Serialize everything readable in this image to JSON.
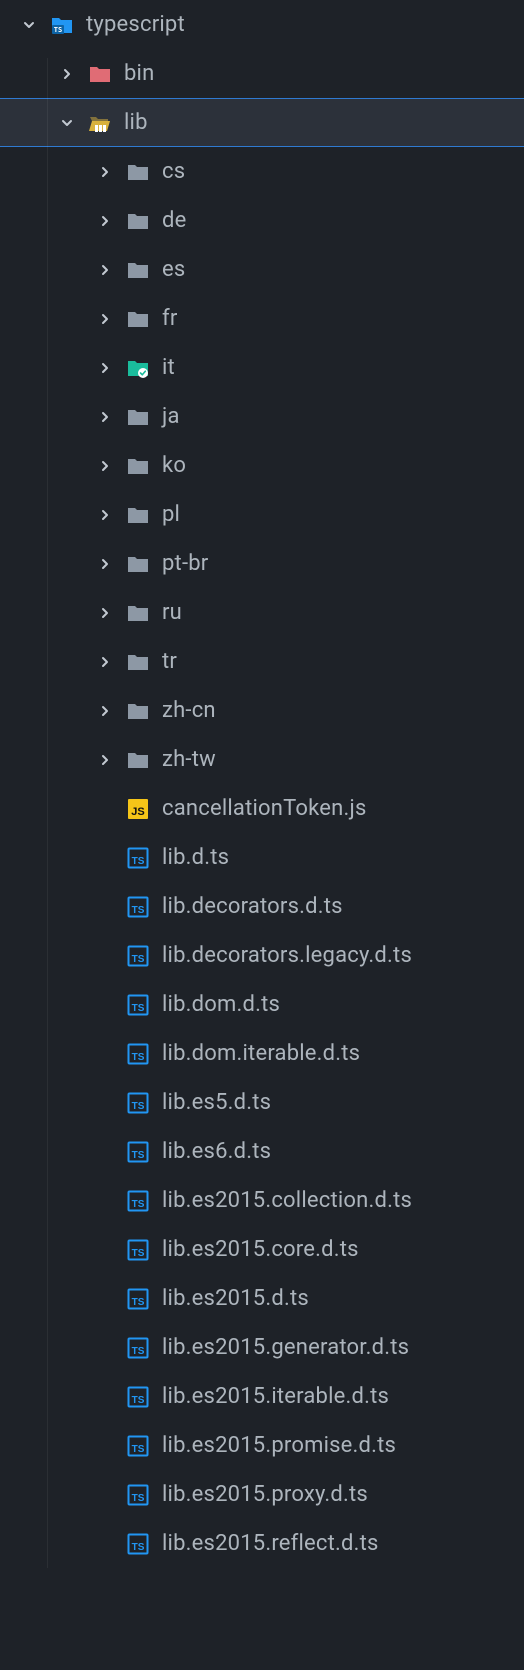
{
  "colors": {
    "bg": "#1e2228",
    "selectedBg": "#2c313a",
    "selectedBorder": "#2f7ad1",
    "text": "#adb5bd",
    "folderIcon": "#8d98a5",
    "tsBlue": "#2196f3",
    "jsYellow": "#f5c518",
    "binRed": "#e06c75",
    "libYellow": "#d8b13d",
    "itTeal": "#1abc9c",
    "tsRootBlue": "#2196f3"
  },
  "rows": [
    {
      "depth": 0,
      "chevron": "down",
      "iconType": "folder-ts-root",
      "label": "typescript",
      "interact": true,
      "selected": false
    },
    {
      "depth": 1,
      "chevron": "right",
      "iconType": "folder-bin",
      "label": "bin",
      "interact": true,
      "selected": false
    },
    {
      "depth": 1,
      "chevron": "down",
      "iconType": "folder-lib",
      "label": "lib",
      "interact": true,
      "selected": true
    },
    {
      "depth": 2,
      "chevron": "right",
      "iconType": "folder",
      "label": "cs",
      "interact": true,
      "selected": false
    },
    {
      "depth": 2,
      "chevron": "right",
      "iconType": "folder",
      "label": "de",
      "interact": true,
      "selected": false
    },
    {
      "depth": 2,
      "chevron": "right",
      "iconType": "folder",
      "label": "es",
      "interact": true,
      "selected": false
    },
    {
      "depth": 2,
      "chevron": "right",
      "iconType": "folder",
      "label": "fr",
      "interact": true,
      "selected": false
    },
    {
      "depth": 2,
      "chevron": "right",
      "iconType": "folder-it",
      "label": "it",
      "interact": true,
      "selected": false
    },
    {
      "depth": 2,
      "chevron": "right",
      "iconType": "folder",
      "label": "ja",
      "interact": true,
      "selected": false
    },
    {
      "depth": 2,
      "chevron": "right",
      "iconType": "folder",
      "label": "ko",
      "interact": true,
      "selected": false
    },
    {
      "depth": 2,
      "chevron": "right",
      "iconType": "folder",
      "label": "pl",
      "interact": true,
      "selected": false
    },
    {
      "depth": 2,
      "chevron": "right",
      "iconType": "folder",
      "label": "pt-br",
      "interact": true,
      "selected": false
    },
    {
      "depth": 2,
      "chevron": "right",
      "iconType": "folder",
      "label": "ru",
      "interact": true,
      "selected": false
    },
    {
      "depth": 2,
      "chevron": "right",
      "iconType": "folder",
      "label": "tr",
      "interact": true,
      "selected": false
    },
    {
      "depth": 2,
      "chevron": "right",
      "iconType": "folder",
      "label": "zh-cn",
      "interact": true,
      "selected": false
    },
    {
      "depth": 2,
      "chevron": "right",
      "iconType": "folder",
      "label": "zh-tw",
      "interact": true,
      "selected": false
    },
    {
      "depth": 2,
      "chevron": "none",
      "iconType": "file-js",
      "label": "cancellationToken.js",
      "interact": true,
      "selected": false
    },
    {
      "depth": 2,
      "chevron": "none",
      "iconType": "file-ts",
      "label": "lib.d.ts",
      "interact": true,
      "selected": false
    },
    {
      "depth": 2,
      "chevron": "none",
      "iconType": "file-ts",
      "label": "lib.decorators.d.ts",
      "interact": true,
      "selected": false
    },
    {
      "depth": 2,
      "chevron": "none",
      "iconType": "file-ts",
      "label": "lib.decorators.legacy.d.ts",
      "interact": true,
      "selected": false
    },
    {
      "depth": 2,
      "chevron": "none",
      "iconType": "file-ts",
      "label": "lib.dom.d.ts",
      "interact": true,
      "selected": false
    },
    {
      "depth": 2,
      "chevron": "none",
      "iconType": "file-ts",
      "label": "lib.dom.iterable.d.ts",
      "interact": true,
      "selected": false
    },
    {
      "depth": 2,
      "chevron": "none",
      "iconType": "file-ts",
      "label": "lib.es5.d.ts",
      "interact": true,
      "selected": false
    },
    {
      "depth": 2,
      "chevron": "none",
      "iconType": "file-ts",
      "label": "lib.es6.d.ts",
      "interact": true,
      "selected": false
    },
    {
      "depth": 2,
      "chevron": "none",
      "iconType": "file-ts",
      "label": "lib.es2015.collection.d.ts",
      "interact": true,
      "selected": false
    },
    {
      "depth": 2,
      "chevron": "none",
      "iconType": "file-ts",
      "label": "lib.es2015.core.d.ts",
      "interact": true,
      "selected": false
    },
    {
      "depth": 2,
      "chevron": "none",
      "iconType": "file-ts",
      "label": "lib.es2015.d.ts",
      "interact": true,
      "selected": false
    },
    {
      "depth": 2,
      "chevron": "none",
      "iconType": "file-ts",
      "label": "lib.es2015.generator.d.ts",
      "interact": true,
      "selected": false
    },
    {
      "depth": 2,
      "chevron": "none",
      "iconType": "file-ts",
      "label": "lib.es2015.iterable.d.ts",
      "interact": true,
      "selected": false
    },
    {
      "depth": 2,
      "chevron": "none",
      "iconType": "file-ts",
      "label": "lib.es2015.promise.d.ts",
      "interact": true,
      "selected": false
    },
    {
      "depth": 2,
      "chevron": "none",
      "iconType": "file-ts",
      "label": "lib.es2015.proxy.d.ts",
      "interact": true,
      "selected": false
    },
    {
      "depth": 2,
      "chevron": "none",
      "iconType": "file-ts",
      "label": "lib.es2015.reflect.d.ts",
      "interact": true,
      "selected": false
    }
  ]
}
